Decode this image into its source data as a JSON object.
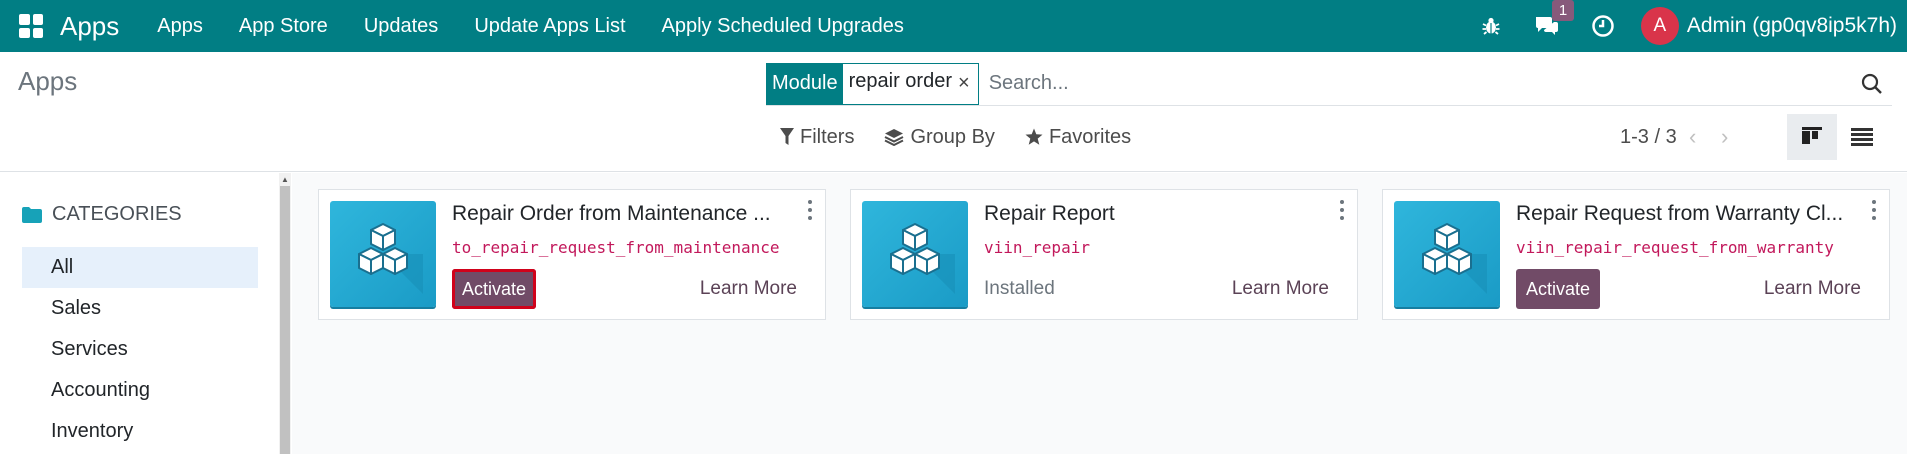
{
  "topbar": {
    "brand": "Apps",
    "menu": [
      "Apps",
      "App Store",
      "Updates",
      "Update Apps List",
      "Apply Scheduled Upgrades"
    ],
    "messages_badge": "1",
    "user_initial": "A",
    "user_name": "Admin (gp0qv8ip5k7h)",
    "icons": [
      "apps-grid-icon",
      "bug-icon",
      "chat-icon",
      "clock-icon"
    ],
    "color": "#017e84"
  },
  "control": {
    "breadcrumb": "Apps",
    "search": {
      "facet_label": "Module",
      "facet_value": "repair order",
      "placeholder": "Search..."
    },
    "filters": [
      "Filters",
      "Group By",
      "Favorites"
    ],
    "pager": "1-3 / 3"
  },
  "sidebar": {
    "header": "CATEGORIES",
    "items": [
      "All",
      "Sales",
      "Services",
      "Accounting",
      "Inventory"
    ],
    "active_index": 0
  },
  "cards": [
    {
      "title": "Repair Order from Maintenance ...",
      "technical_name": "to_repair_request_from_maintenance",
      "action": "Activate",
      "learn_more": "Learn More"
    },
    {
      "title": "Repair Report",
      "technical_name": "viin_repair",
      "status": "Installed",
      "learn_more": "Learn More"
    },
    {
      "title": "Repair Request from Warranty Cl...",
      "technical_name": "viin_repair_request_from_warranty",
      "action": "Activate",
      "learn_more": "Learn More"
    }
  ],
  "colors": {
    "primary": "#714b67",
    "tech_name": "#c2185b",
    "highlight_border": "#d0021b",
    "icon_bg": "#2fb6dc"
  }
}
